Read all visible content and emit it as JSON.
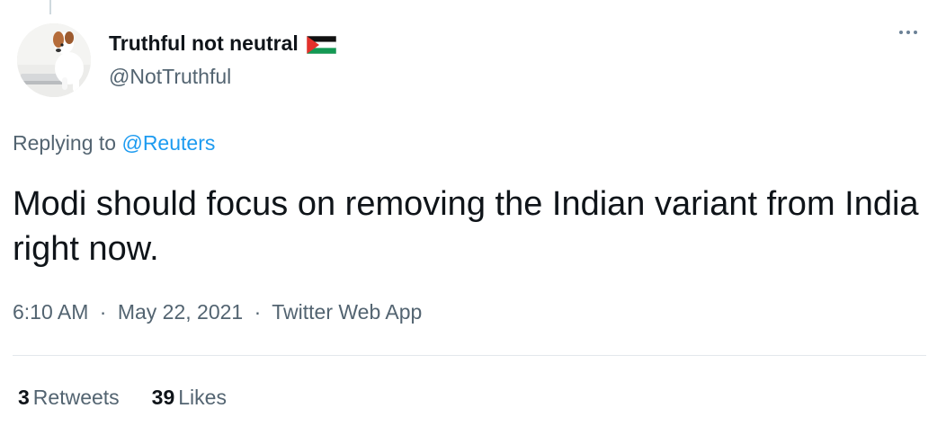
{
  "user": {
    "display_name": "Truthful not neutral",
    "handle": "@NotTruthful",
    "flag": "palestine-flag"
  },
  "reply": {
    "prefix": "Replying to",
    "mention": "@Reuters"
  },
  "tweet": {
    "text": "Modi should focus on removing the Indian variant from India right now."
  },
  "meta": {
    "time": "6:10 AM",
    "separator": "·",
    "date": "May 22, 2021",
    "app": "Twitter Web App"
  },
  "stats": {
    "retweets_count": "3",
    "retweets_label": "Retweets",
    "likes_count": "39",
    "likes_label": "Likes"
  },
  "colors": {
    "accent": "#1d9bf0",
    "secondary_text": "#536471",
    "primary_text": "#0f1419"
  },
  "icons": {
    "more": "more-dots-icon"
  }
}
